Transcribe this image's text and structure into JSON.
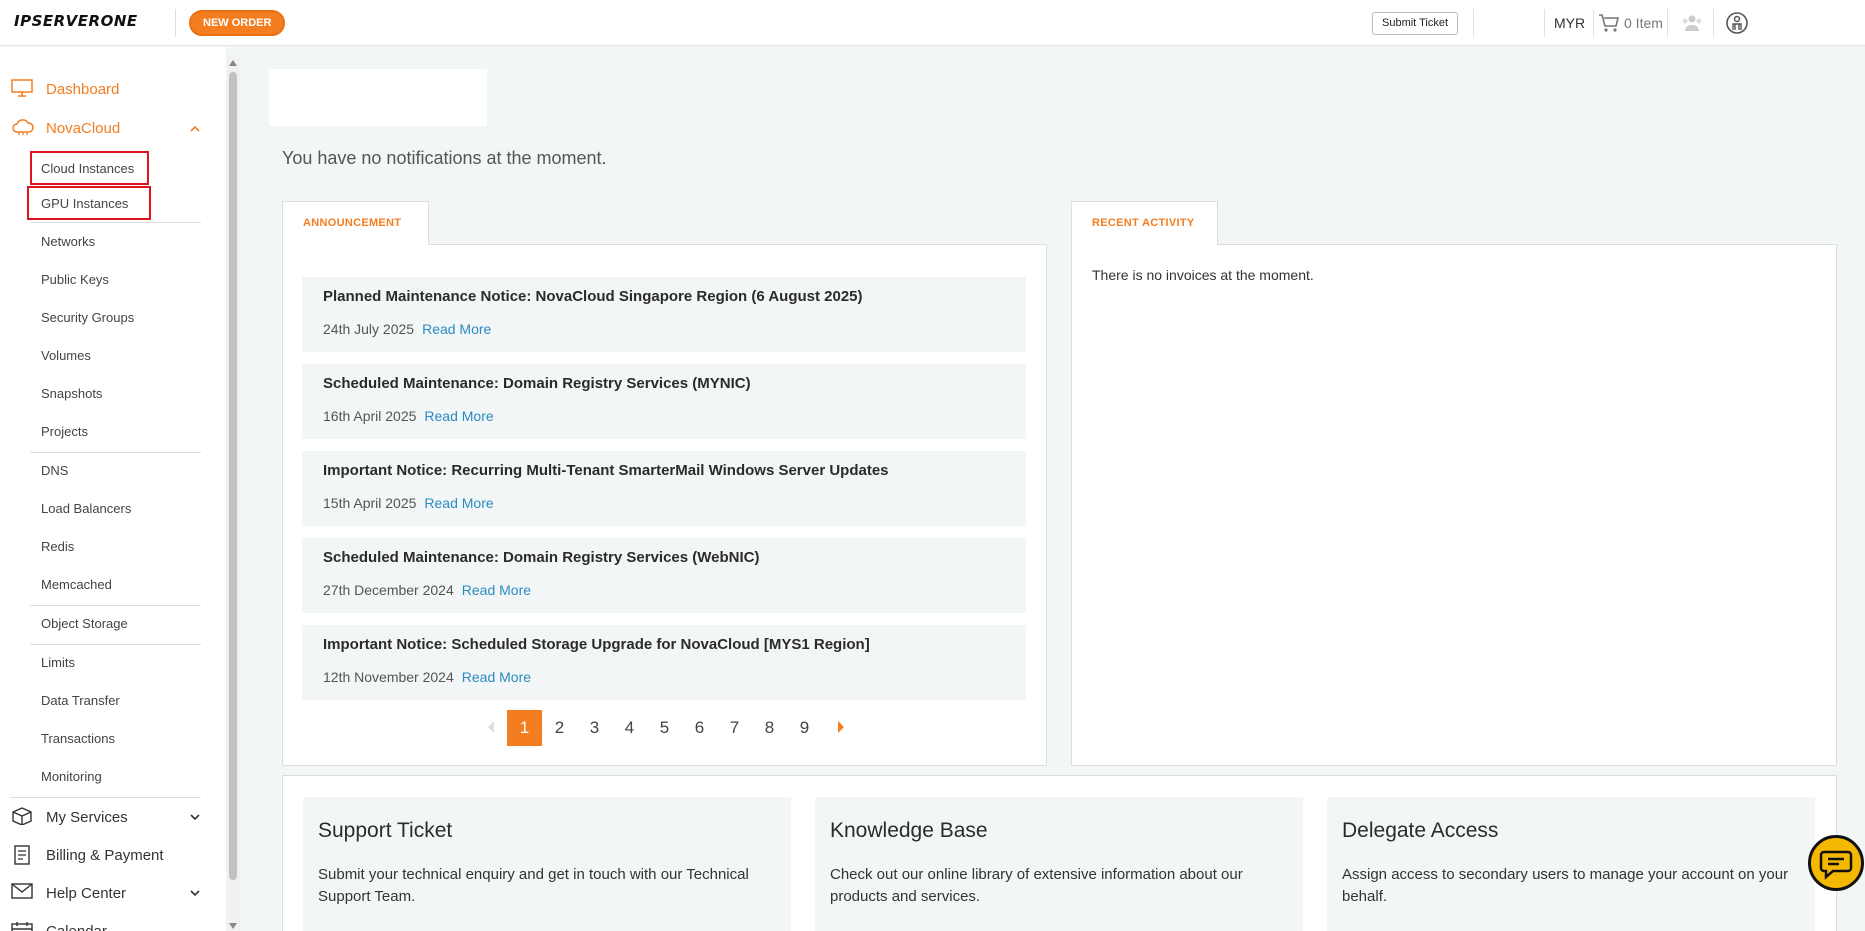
{
  "header": {
    "logo": "IPSERVERONE",
    "new_order": "NEW ORDER",
    "submit_ticket": "Submit Ticket",
    "currency": "MYR",
    "cart": "0 Item"
  },
  "sidebar": {
    "dashboard": "Dashboard",
    "novacloud": "NovaCloud",
    "items": [
      "Cloud Instances",
      "GPU Instances",
      "Networks",
      "Public Keys",
      "Security Groups",
      "Volumes",
      "Snapshots",
      "Projects",
      "DNS",
      "Load Balancers",
      "Redis",
      "Memcached",
      "Object Storage",
      "Limits",
      "Data Transfer",
      "Transactions",
      "Monitoring"
    ],
    "my_services": "My Services",
    "billing": "Billing & Payment",
    "help": "Help Center",
    "calendar": "Calendar"
  },
  "main": {
    "no_notifications": "You have no notifications at the moment.",
    "announcement_tab": "ANNOUNCEMENT",
    "recent_activity_tab": "RECENT ACTIVITY",
    "no_invoices": "There is no invoices at the moment.",
    "read_more": "Read More",
    "announcements": [
      {
        "title": "Planned Maintenance Notice: NovaCloud Singapore Region (6 August 2025)",
        "date": "24th July 2025"
      },
      {
        "title": "Scheduled Maintenance: Domain Registry Services (MYNIC)",
        "date": "16th April 2025"
      },
      {
        "title": "Important Notice: Recurring Multi-Tenant SmarterMail Windows Server Updates",
        "date": "15th April 2025"
      },
      {
        "title": "Scheduled Maintenance: Domain Registry Services (WebNIC)",
        "date": "27th December 2024"
      },
      {
        "title": "Important Notice: Scheduled Storage Upgrade for NovaCloud [MYS1 Region]",
        "date": "12th November 2024"
      }
    ],
    "pages": [
      "1",
      "2",
      "3",
      "4",
      "5",
      "6",
      "7",
      "8",
      "9"
    ],
    "cards": [
      {
        "title": "Support Ticket",
        "desc": "Submit your technical enquiry and get in touch with our Technical Support Team."
      },
      {
        "title": "Knowledge Base",
        "desc": "Check out our online library of extensive information about our products and services."
      },
      {
        "title": "Delegate Access",
        "desc": "Assign access to secondary users to manage your account on your behalf."
      }
    ]
  },
  "colors": {
    "accent": "#f47d20",
    "link": "#2a8bc0",
    "highlight": "#e0141e"
  }
}
